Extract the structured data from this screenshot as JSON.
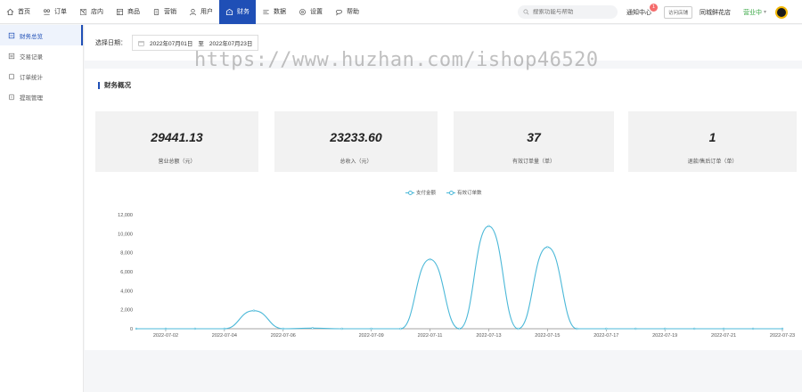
{
  "nav": {
    "items": [
      {
        "label": "首页",
        "icon": "home-icon"
      },
      {
        "label": "订单",
        "icon": "order-icon"
      },
      {
        "label": "店内",
        "icon": "store-icon"
      },
      {
        "label": "商品",
        "icon": "goods-icon"
      },
      {
        "label": "营销",
        "icon": "marketing-icon"
      },
      {
        "label": "用户",
        "icon": "user-icon"
      },
      {
        "label": "财务",
        "icon": "finance-icon",
        "active": true
      },
      {
        "label": "数据",
        "icon": "data-icon"
      },
      {
        "label": "设置",
        "icon": "settings-icon"
      },
      {
        "label": "帮助",
        "icon": "help-icon"
      }
    ]
  },
  "header": {
    "search_placeholder": "搜索功能与帮助",
    "notice_label": "通知中心",
    "notice_count": "1",
    "promo_label": "访问店铺",
    "shop_name": "同城鲜花店",
    "status_label": "营业中",
    "status_caret": "▾"
  },
  "sidebar": {
    "items": [
      {
        "label": "财务总览",
        "active": true
      },
      {
        "label": "交易记录"
      },
      {
        "label": "订单统计"
      },
      {
        "label": "提现管理"
      }
    ]
  },
  "filter": {
    "label": "选择日期：",
    "start": "2022年07月01日",
    "separator": "至",
    "end": "2022年07月23日"
  },
  "watermark": "https://www.huzhan.com/ishop46520",
  "overview": {
    "title": "财务概况",
    "cards": [
      {
        "value": "29441.13",
        "label": "营业总额（元）"
      },
      {
        "value": "23233.60",
        "label": "总收入（元）"
      },
      {
        "value": "37",
        "label": "有效订单量（单）"
      },
      {
        "value": "1",
        "label": "退款/售后订单（单）"
      }
    ]
  },
  "colors": {
    "accent": "#1f4fb6",
    "line": "#4bb8d8",
    "status": "#3aa845"
  },
  "chart_data": {
    "type": "line",
    "x": [
      "2022-07-01",
      "2022-07-02",
      "2022-07-03",
      "2022-07-04",
      "2022-07-05",
      "2022-07-06",
      "2022-07-07",
      "2022-07-08",
      "2022-07-09",
      "2022-07-10",
      "2022-07-11",
      "2022-07-12",
      "2022-07-13",
      "2022-07-14",
      "2022-07-15",
      "2022-07-16",
      "2022-07-17",
      "2022-07-18",
      "2022-07-19",
      "2022-07-20",
      "2022-07-21",
      "2022-07-22",
      "2022-07-23"
    ],
    "xticks": [
      "2022-07-02",
      "2022-07-04",
      "2022-07-06",
      "2022-07-09",
      "2022-07-11",
      "2022-07-13",
      "2022-07-15",
      "2022-07-17",
      "2022-07-19",
      "2022-07-21",
      "2022-07-23"
    ],
    "series": [
      {
        "name": "支付金额",
        "values": [
          0,
          0,
          0,
          0,
          1900,
          0,
          60,
          0,
          0,
          0,
          7300,
          0,
          10800,
          0,
          8600,
          0,
          0,
          0,
          0,
          0,
          0,
          0,
          0
        ]
      },
      {
        "name": "有效订单数",
        "values": [
          0,
          0,
          0,
          0,
          1,
          0,
          1,
          0,
          0,
          0,
          8,
          0,
          14,
          0,
          12,
          0,
          0,
          0,
          0,
          0,
          0,
          0,
          0
        ]
      }
    ],
    "yticks": [
      "0",
      "2,000",
      "4,000",
      "6,000",
      "8,000",
      "10,000",
      "12,000"
    ],
    "ylim": [
      0,
      12000
    ],
    "grid": false,
    "legend": "top-center"
  }
}
